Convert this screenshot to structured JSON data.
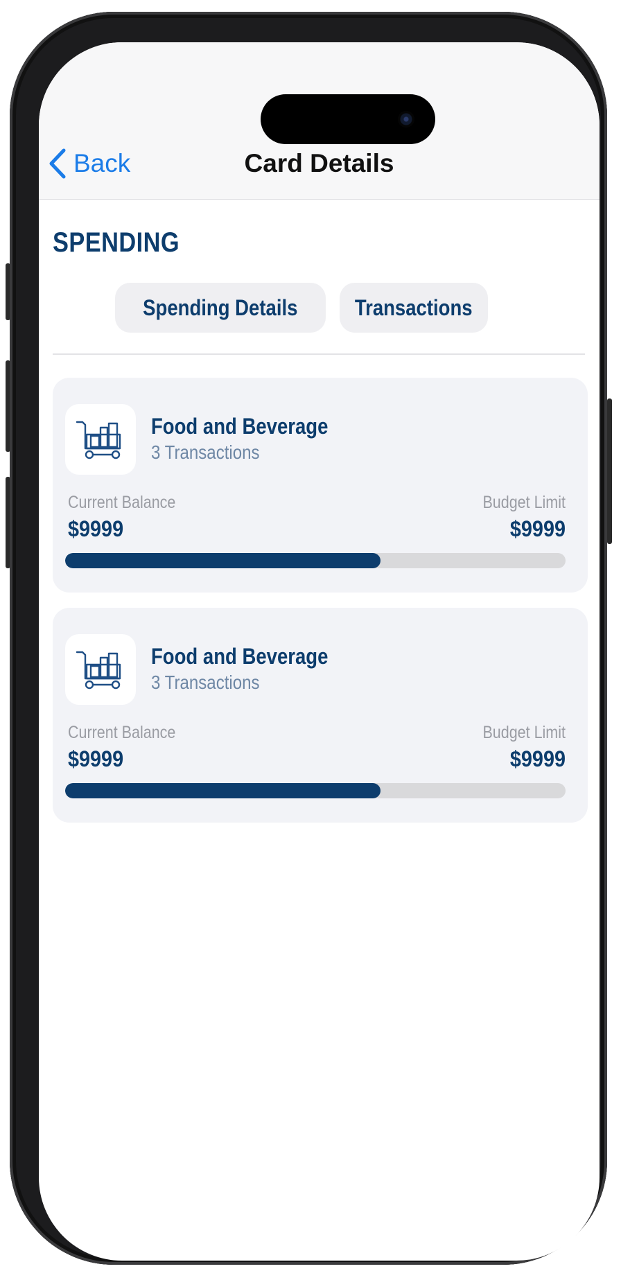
{
  "nav": {
    "back_label": "Back",
    "title": "Card Details"
  },
  "section": {
    "title": "SPENDING"
  },
  "tabs": [
    {
      "label": "Spending Details"
    },
    {
      "label": "Transactions"
    }
  ],
  "cards": [
    {
      "title": "Food and Beverage",
      "subtitle": "3 Transactions",
      "icon": "shopping-cart-icon",
      "balance_label": "Current Balance",
      "balance_value": "$9999",
      "limit_label": "Budget Limit",
      "limit_value": "$9999",
      "progress_fraction": 0.63
    },
    {
      "title": "Food and Beverage",
      "subtitle": "3 Transactions",
      "icon": "shopping-cart-icon",
      "balance_label": "Current Balance",
      "balance_value": "$9999",
      "limit_label": "Budget Limit",
      "limit_value": "$9999",
      "progress_fraction": 0.63
    }
  ],
  "colors": {
    "brand_navy": "#0d3d6d",
    "link_blue": "#1b7ce8",
    "card_bg": "#f2f3f7",
    "track_gray": "#d9d9db"
  }
}
